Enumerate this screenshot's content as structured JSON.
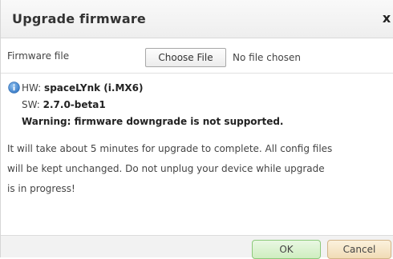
{
  "dialog": {
    "title": "Upgrade firmware",
    "close_glyph": "x"
  },
  "file_row": {
    "label": "Firmware file",
    "choose_button": "Choose File",
    "status": "No file chosen"
  },
  "info": {
    "icon": "info-icon",
    "hw_prefix": "HW: ",
    "hw_value": "spaceLYnk (i.MX6)",
    "sw_prefix": "SW: ",
    "sw_value": "2.7.0-beta1",
    "warning": "Warning: firmware downgrade is not supported.",
    "message_lines": [
      "It will take about 5 minutes for upgrade to complete. All config files",
      "will be kept unchanged. Do not unplug your device while upgrade",
      "is in progress!"
    ]
  },
  "footer": {
    "ok_label": "OK",
    "cancel_label": "Cancel"
  },
  "colors": {
    "info_icon": "#4a90d9",
    "ok_border": "#8cc97a",
    "cancel_border": "#d2b487"
  }
}
